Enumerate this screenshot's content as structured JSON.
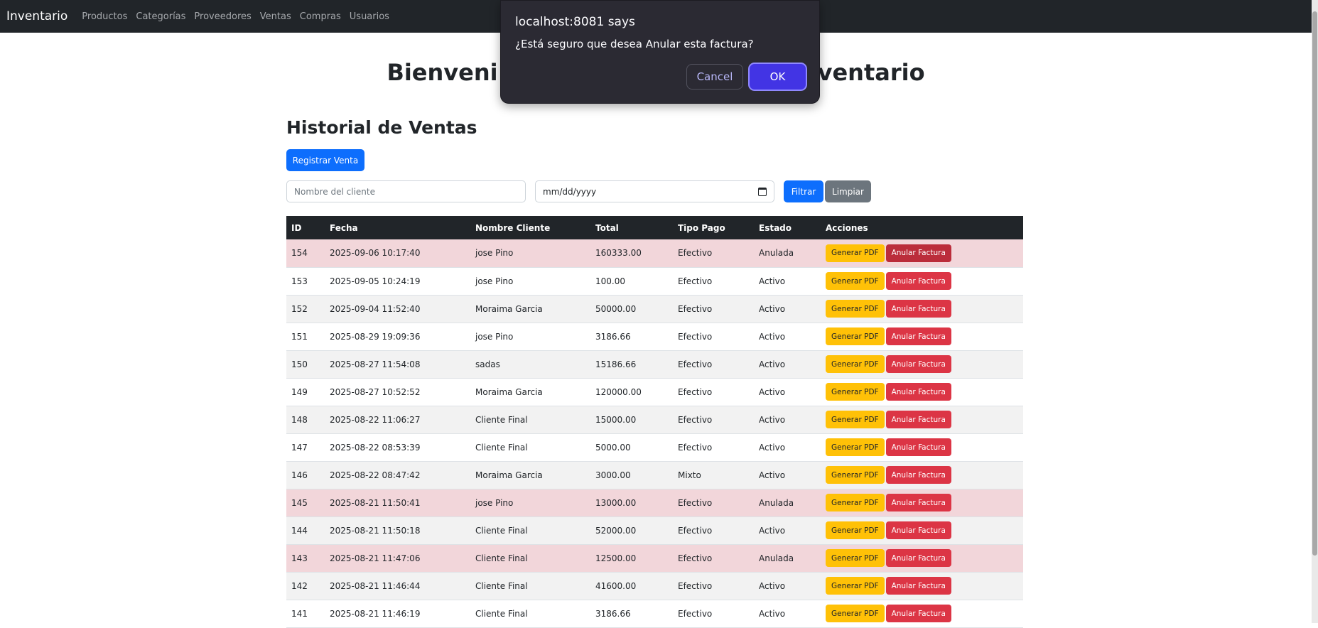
{
  "navbar": {
    "brand": "Inventario",
    "links": [
      "Productos",
      "Categorías",
      "Proveedores",
      "Ventas",
      "Compras",
      "Usuarios"
    ]
  },
  "welcome": {
    "left": "Bienveni",
    "right": "ventario"
  },
  "page_title": "Historial de Ventas",
  "register_button": "Registrar Venta",
  "filters": {
    "cliente_placeholder": "Nombre del cliente",
    "fecha_placeholder": "mm/dd/yyyy",
    "filtrar": "Filtrar",
    "limpiar": "Limpiar"
  },
  "table": {
    "headers": [
      "ID",
      "Fecha",
      "Nombre Cliente",
      "Total",
      "Tipo Pago",
      "Estado",
      "Acciones"
    ],
    "pdf_label": "Generar PDF",
    "anular_label": "Anular Factura",
    "rows": [
      {
        "id": "154",
        "fecha": "2025-09-06 10:17:40",
        "cliente": "jose Pino",
        "total": "160333.00",
        "pago": "Efectivo",
        "estado": "Anulada"
      },
      {
        "id": "153",
        "fecha": "2025-09-05 10:24:19",
        "cliente": "jose Pino",
        "total": "100.00",
        "pago": "Efectivo",
        "estado": "Activo"
      },
      {
        "id": "152",
        "fecha": "2025-09-04 11:52:40",
        "cliente": "Moraima Garcia",
        "total": "50000.00",
        "pago": "Efectivo",
        "estado": "Activo"
      },
      {
        "id": "151",
        "fecha": "2025-08-29 19:09:36",
        "cliente": "jose Pino",
        "total": "3186.66",
        "pago": "Efectivo",
        "estado": "Activo"
      },
      {
        "id": "150",
        "fecha": "2025-08-27 11:54:08",
        "cliente": "sadas",
        "total": "15186.66",
        "pago": "Efectivo",
        "estado": "Activo"
      },
      {
        "id": "149",
        "fecha": "2025-08-27 10:52:52",
        "cliente": "Moraima Garcia",
        "total": "120000.00",
        "pago": "Efectivo",
        "estado": "Activo"
      },
      {
        "id": "148",
        "fecha": "2025-08-22 11:06:27",
        "cliente": "Cliente Final",
        "total": "15000.00",
        "pago": "Efectivo",
        "estado": "Activo"
      },
      {
        "id": "147",
        "fecha": "2025-08-22 08:53:39",
        "cliente": "Cliente Final",
        "total": "5000.00",
        "pago": "Efectivo",
        "estado": "Activo"
      },
      {
        "id": "146",
        "fecha": "2025-08-22 08:47:42",
        "cliente": "Moraima Garcia",
        "total": "3000.00",
        "pago": "Mixto",
        "estado": "Activo"
      },
      {
        "id": "145",
        "fecha": "2025-08-21 11:50:41",
        "cliente": "jose Pino",
        "total": "13000.00",
        "pago": "Efectivo",
        "estado": "Anulada"
      },
      {
        "id": "144",
        "fecha": "2025-08-21 11:50:18",
        "cliente": "Cliente Final",
        "total": "52000.00",
        "pago": "Efectivo",
        "estado": "Activo"
      },
      {
        "id": "143",
        "fecha": "2025-08-21 11:47:06",
        "cliente": "Cliente Final",
        "total": "12500.00",
        "pago": "Efectivo",
        "estado": "Anulada"
      },
      {
        "id": "142",
        "fecha": "2025-08-21 11:46:44",
        "cliente": "Cliente Final",
        "total": "41600.00",
        "pago": "Efectivo",
        "estado": "Activo"
      },
      {
        "id": "141",
        "fecha": "2025-08-21 11:46:19",
        "cliente": "Cliente Final",
        "total": "3186.66",
        "pago": "Efectivo",
        "estado": "Activo"
      }
    ]
  },
  "dialog": {
    "title": "localhost:8081 says",
    "message": "¿Está seguro que desea Anular esta factura?",
    "cancel": "Cancel",
    "ok": "OK"
  },
  "colors": {
    "navbar": "#212529",
    "primary": "#0d6efd",
    "warning": "#ffc107",
    "danger": "#dc3545",
    "anulada_row": "#f2d6da",
    "dialog_bg": "#2b2a33",
    "dialog_ok": "#4234e4"
  }
}
